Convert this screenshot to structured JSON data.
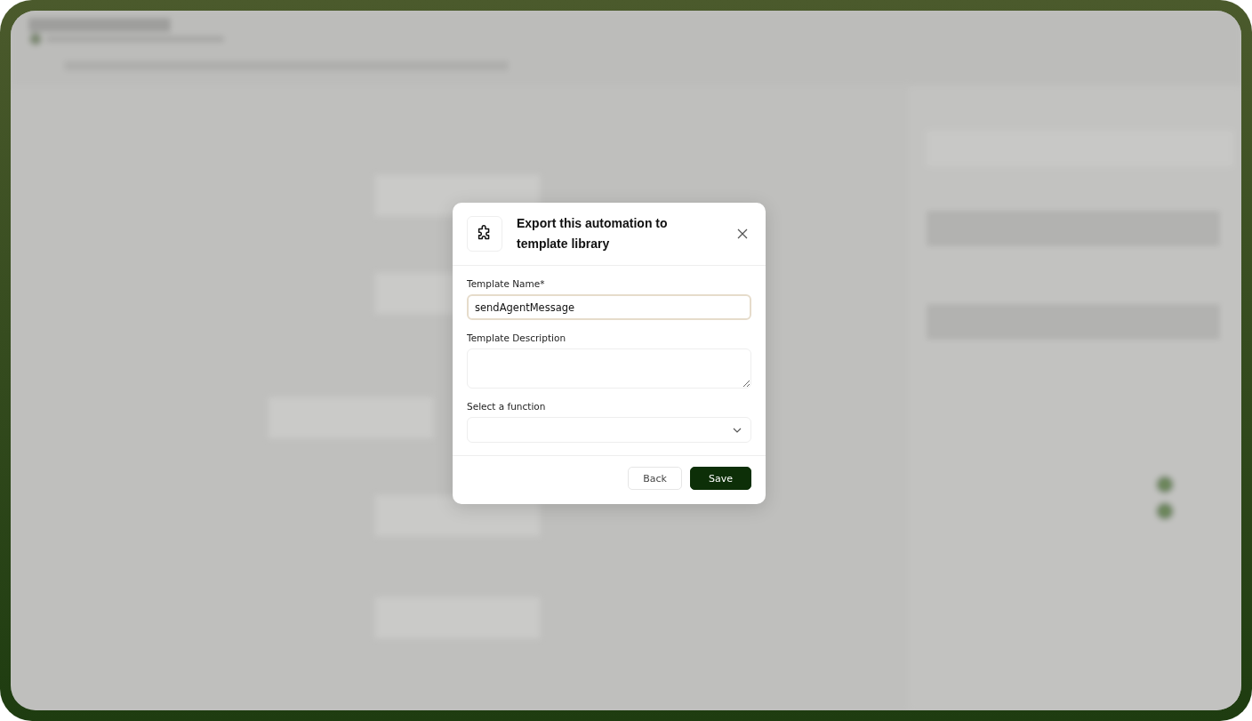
{
  "dialog": {
    "title": "Export this automation to template library",
    "fields": [
      {
        "kind": "text",
        "label": "Template Name*",
        "value": "sendAgentMessage",
        "focused": true
      },
      {
        "kind": "textarea",
        "label": "Template Description",
        "focused": false
      },
      {
        "kind": "select",
        "label": "Select a function",
        "focused": false
      }
    ],
    "buttons": [
      {
        "kind": "secondary",
        "label": "Back"
      },
      {
        "kind": "primary",
        "label": "Save"
      }
    ]
  }
}
